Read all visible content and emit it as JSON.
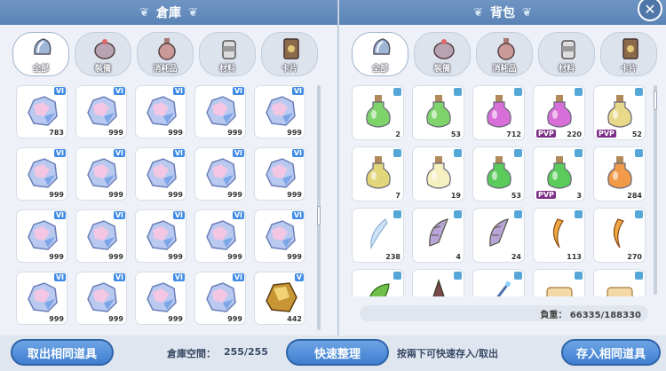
{
  "warehouse": {
    "title": "倉庫",
    "tabs": [
      "全部",
      "裝備",
      "消耗品",
      "材料",
      "卡片"
    ],
    "items": [
      {
        "qty": "783",
        "rank": "VI"
      },
      {
        "qty": "999",
        "rank": "VI"
      },
      {
        "qty": "999",
        "rank": "VI"
      },
      {
        "qty": "999",
        "rank": "VI"
      },
      {
        "qty": "999",
        "rank": "VI"
      },
      {
        "qty": "999",
        "rank": "VI"
      },
      {
        "qty": "999",
        "rank": "VI"
      },
      {
        "qty": "999",
        "rank": "VI"
      },
      {
        "qty": "999",
        "rank": "VI"
      },
      {
        "qty": "999",
        "rank": "VI"
      },
      {
        "qty": "999",
        "rank": "VI"
      },
      {
        "qty": "999",
        "rank": "VI"
      },
      {
        "qty": "999",
        "rank": "VI"
      },
      {
        "qty": "999",
        "rank": "VI"
      },
      {
        "qty": "999",
        "rank": "VI"
      },
      {
        "qty": "999",
        "rank": "VI"
      },
      {
        "qty": "999",
        "rank": "VI"
      },
      {
        "qty": "999",
        "rank": "VI"
      },
      {
        "qty": "999",
        "rank": "VI"
      },
      {
        "qty": "442",
        "rank": "V"
      }
    ]
  },
  "bag": {
    "title": "背包",
    "tabs": [
      "全部",
      "裝備",
      "消耗品",
      "材料",
      "卡片"
    ],
    "items": [
      {
        "qty": "2",
        "pvp": ""
      },
      {
        "qty": "53",
        "pvp": ""
      },
      {
        "qty": "712",
        "pvp": ""
      },
      {
        "qty": "220",
        "pvp": "PVP"
      },
      {
        "qty": "52",
        "pvp": "PVP"
      },
      {
        "qty": "7",
        "pvp": ""
      },
      {
        "qty": "19",
        "pvp": ""
      },
      {
        "qty": "53",
        "pvp": ""
      },
      {
        "qty": "3",
        "pvp": "PVP"
      },
      {
        "qty": "284",
        "pvp": ""
      },
      {
        "qty": "238",
        "pvp": ""
      },
      {
        "qty": "4",
        "pvp": ""
      },
      {
        "qty": "24",
        "pvp": ""
      },
      {
        "qty": "113",
        "pvp": ""
      },
      {
        "qty": "270",
        "pvp": ""
      },
      {
        "qty": "",
        "pvp": ""
      },
      {
        "qty": "",
        "pvp": ""
      },
      {
        "qty": "",
        "pvp": ""
      },
      {
        "qty": "",
        "pvp": ""
      },
      {
        "qty": "",
        "pvp": ""
      }
    ],
    "weight": "負重： 66335/188330"
  },
  "footer": {
    "take_same": "取出相同道具",
    "space_label": "倉庫空間：",
    "space_value": "255/255",
    "quick_sort": "快速整理",
    "hint": "按兩下可快速存入/取出",
    "store_same": "存入相同道具"
  },
  "icons": {
    "close": "close-icon",
    "wing": "wing-icon"
  },
  "colors": {
    "accent": "#3f7fd1",
    "rank_badge": "#3f8be6",
    "pvp_badge": "#7b2f86",
    "lock": "#55a7d8"
  }
}
